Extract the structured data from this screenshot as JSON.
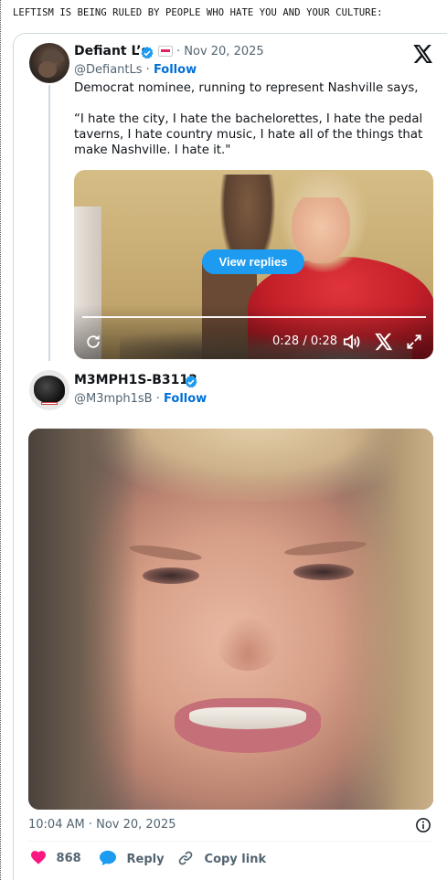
{
  "headline": "LEFTISM IS BEING RULED BY PEOPLE WHO HATE YOU AND YOUR CULTURE:",
  "colors": {
    "accent": "#1d9bf0",
    "follow": "#006fd6",
    "like": "#f91880",
    "muted": "#536471"
  },
  "quoted_tweet": {
    "author_name": "Defiant L’s",
    "handle": "@DefiantLs",
    "date": "· Nov 20, 2025",
    "separator": "·",
    "follow_label": "Follow",
    "text_1": "Democrat nominee, running to represent Nashville says,",
    "text_2": "“I hate the city, I hate the bachelorettes, I hate the pedal taverns, I hate country music, I hate all of the things that make Nashville. I hate it.\"",
    "video": {
      "view_replies_label": "View replies",
      "time": "0:28 / 0:28",
      "progress": 1.0,
      "controls": [
        "replay-icon",
        "volume-icon",
        "x-logo-icon",
        "expand-icon"
      ]
    }
  },
  "reply_tweet": {
    "author_name": "M3MPH1S-B3113",
    "handle": "@M3mph1sB",
    "separator": "·",
    "follow_label": "Follow",
    "timestamp": "10:04 AM · Nov 20, 2025"
  },
  "actions": {
    "like_count": "868",
    "reply_label": "Reply",
    "copy_link_label": "Copy link"
  }
}
